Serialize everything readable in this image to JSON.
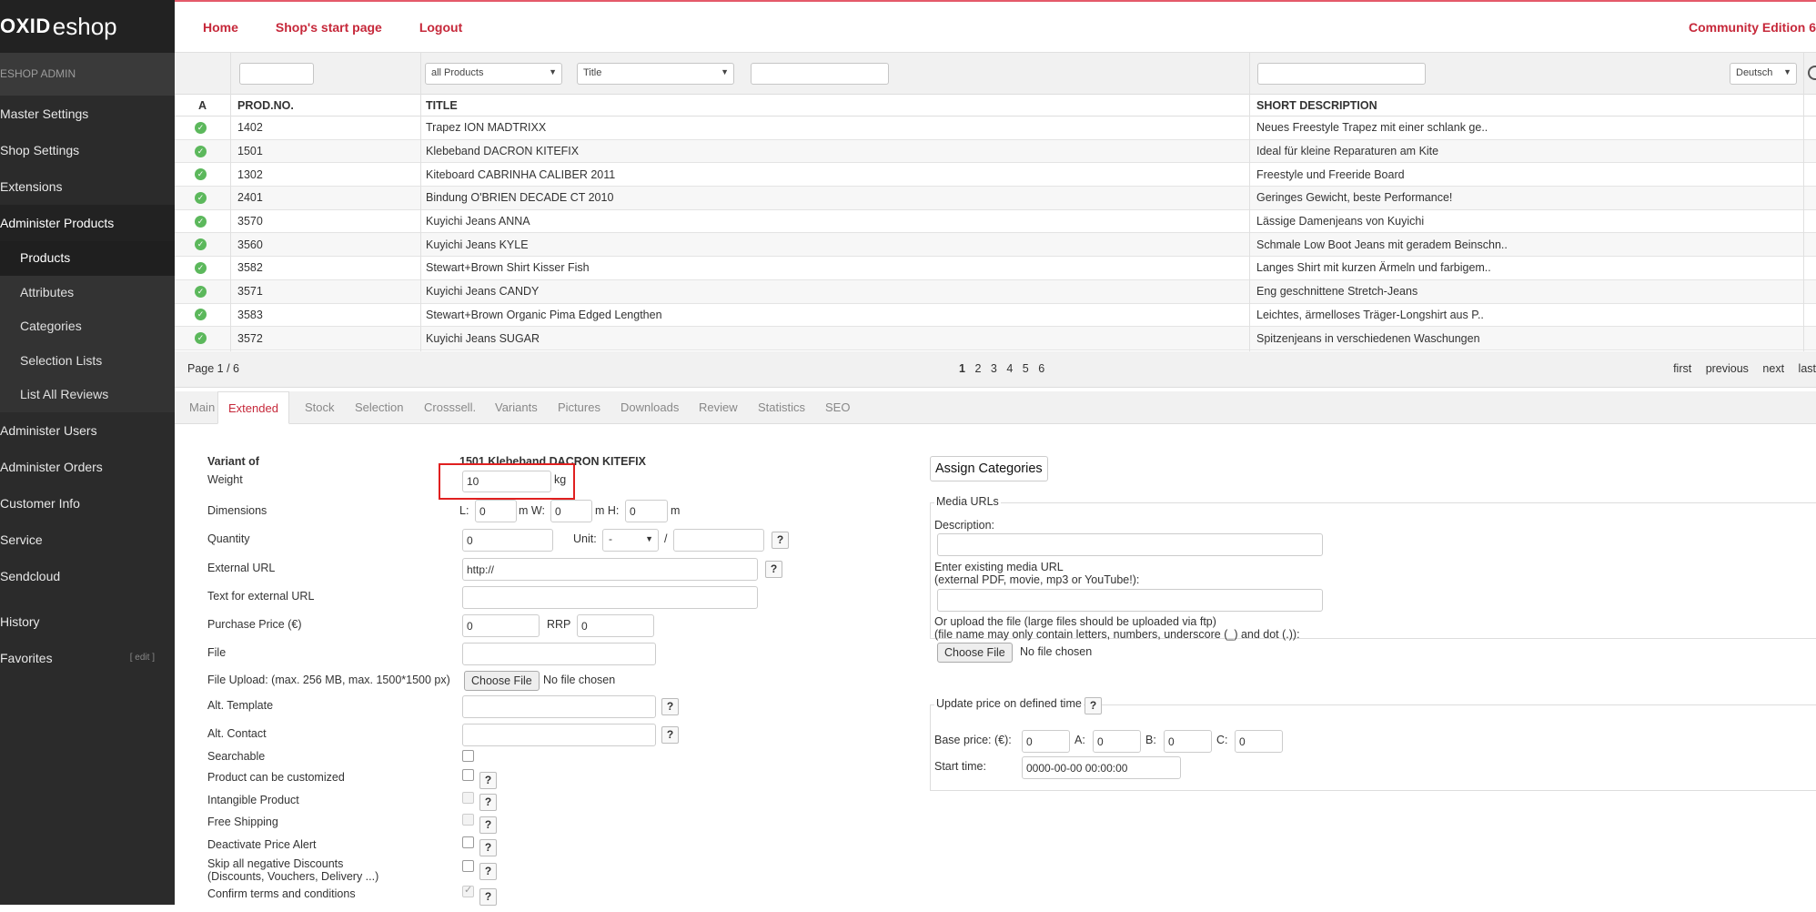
{
  "sidebar": {
    "logo_bold": "OXID",
    "logo_text": "eshop",
    "admin_label": "ESHOP ADMIN",
    "items": [
      {
        "label": "Master Settings"
      },
      {
        "label": "Shop Settings"
      },
      {
        "label": "Extensions"
      },
      {
        "label": "Administer Products"
      }
    ],
    "sub_items": [
      {
        "label": "Products"
      },
      {
        "label": "Attributes"
      },
      {
        "label": "Categories"
      },
      {
        "label": "Selection Lists"
      },
      {
        "label": "List All Reviews"
      }
    ],
    "items_after": [
      {
        "label": "Administer Users"
      },
      {
        "label": "Administer Orders"
      },
      {
        "label": "Customer Info"
      },
      {
        "label": "Service"
      },
      {
        "label": "Sendcloud"
      }
    ],
    "history": "History",
    "favorites": "Favorites",
    "favorites_edit": "[ edit ]"
  },
  "topbar": {
    "home": "Home",
    "start_page": "Shop's start page",
    "logout": "Logout",
    "edition": "Community Edition 6"
  },
  "filters": {
    "type_select": "all Products",
    "field_select": "Title",
    "language_select": "Deutsch"
  },
  "grid": {
    "headers": {
      "active": "A",
      "prodno": "PROD.NO.",
      "title": "TITLE",
      "short": "SHORT DESCRIPTION"
    },
    "rows": [
      {
        "prodno": "1402",
        "title": "Trapez ION MADTRIXX",
        "short": "Neues Freestyle Trapez mit einer schlank ge.."
      },
      {
        "prodno": "1501",
        "title": "Klebeband DACRON KITEFIX",
        "short": "Ideal für kleine Reparaturen am Kite"
      },
      {
        "prodno": "1302",
        "title": "Kiteboard CABRINHA CALIBER 2011",
        "short": "Freestyle und Freeride Board"
      },
      {
        "prodno": "2401",
        "title": "Bindung O'BRIEN DECADE CT 2010",
        "short": "Geringes Gewicht, beste Performance!"
      },
      {
        "prodno": "3570",
        "title": "Kuyichi Jeans ANNA",
        "short": "Lässige Damenjeans von Kuyichi"
      },
      {
        "prodno": "3560",
        "title": "Kuyichi Jeans KYLE",
        "short": "Schmale Low Boot Jeans mit geradem Beinschn.."
      },
      {
        "prodno": "3582",
        "title": "Stewart+Brown Shirt Kisser Fish",
        "short": "Langes Shirt mit kurzen Ärmeln und farbigem.."
      },
      {
        "prodno": "3571",
        "title": "Kuyichi Jeans CANDY",
        "short": "Eng geschnittene Stretch-Jeans"
      },
      {
        "prodno": "3583",
        "title": "Stewart+Brown Organic Pima Edged Lengthen",
        "short": "Leichtes, ärmelloses Träger-Longshirt aus P.."
      },
      {
        "prodno": "3572",
        "title": "Kuyichi Jeans SUGAR",
        "short": "Spitzenjeans in verschiedenen Waschungen"
      }
    ]
  },
  "pager": {
    "info": "Page 1 / 6",
    "pages": [
      "1",
      "2",
      "3",
      "4",
      "5",
      "6"
    ],
    "first": "first",
    "previous": "previous",
    "next": "next",
    "last": "last"
  },
  "tabs": [
    "Main",
    "Extended",
    "Stock",
    "Selection",
    "Crosssell.",
    "Variants",
    "Pictures",
    "Downloads",
    "Review",
    "Statistics",
    "SEO"
  ],
  "form": {
    "variant_of_label": "Variant of",
    "variant_of_value": "1501 Klebeband DACRON KITEFIX",
    "weight_label": "Weight",
    "weight_value": "10",
    "weight_unit": "kg",
    "dimensions_label": "Dimensions",
    "dim_l_label": "L:",
    "dim_l_value": "0",
    "dim_m_w": "m W:",
    "dim_w_value": "0",
    "dim_m_h": "m H:",
    "dim_h_value": "0",
    "dim_m": "m",
    "quantity_label": "Quantity",
    "quantity_value": "0",
    "unit_label": "Unit:",
    "unit_select": "-",
    "unit_slash": "/",
    "external_url_label": "External URL",
    "external_url_value": "http://",
    "ext_url_text_label": "Text for external URL",
    "purchase_price_label": "Purchase Price (€)",
    "purchase_price_value": "0",
    "rrp_label": "RRP",
    "rrp_value": "0",
    "file_label": "File",
    "file_upload_label": "File Upload: (max. 256 MB, max. 1500*1500 px)",
    "choose_file": "Choose File",
    "no_file": "No file chosen",
    "alt_template_label": "Alt. Template",
    "alt_contact_label": "Alt. Contact",
    "searchable_label": "Searchable",
    "customizable_label": "Product can be customized",
    "intangible_label": "Intangible Product",
    "free_shipping_label": "Free Shipping",
    "price_alert_label": "Deactivate Price Alert",
    "skip_discounts_label": "Skip all negative Discounts",
    "skip_discounts_sub": "(Discounts, Vouchers, Delivery ...)",
    "confirm_terms_label": "Confirm terms and conditions",
    "help_glyph": "?"
  },
  "right": {
    "assign_categories": "Assign Categories",
    "media_urls_legend": "Media URLs",
    "description_label": "Description:",
    "enter_media_line1": "Enter existing media URL",
    "enter_media_line2": "(external PDF, movie, mp3 or YouTube!):",
    "upload_line1": "Or upload the file (large files should be uploaded via ftp)",
    "upload_line2": "(file name may only contain letters, numbers, underscore (_) and dot (.)):",
    "choose_file": "Choose File",
    "no_file": "No file chosen",
    "update_price_legend": "Update price on defined time",
    "base_price_label": "Base price: (€):",
    "base_price_value": "0",
    "a_label": "A:",
    "a_value": "0",
    "b_label": "B:",
    "b_value": "0",
    "c_label": "C:",
    "c_value": "0",
    "start_time_label": "Start time:",
    "start_time_value": "0000-00-00 00:00:00"
  },
  "colors": {
    "accent": "#c6283a",
    "sidebar": "#2b2b2b",
    "highlight": "#e02020",
    "active_icon": "#5cb85c"
  }
}
